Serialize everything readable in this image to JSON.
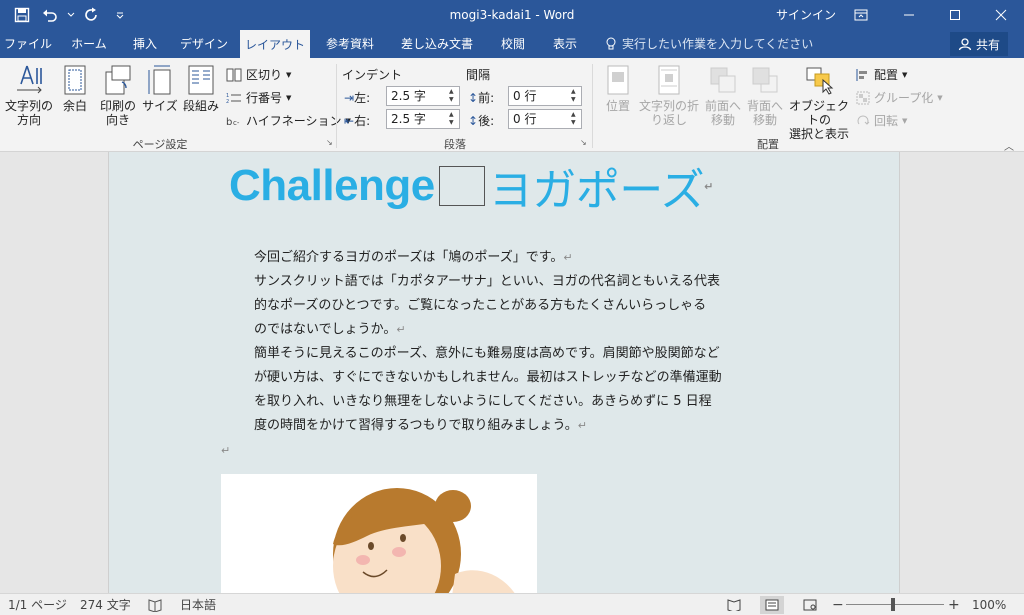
{
  "window": {
    "title": "mogi3-kadai1  -  Word",
    "signin": "サインイン"
  },
  "tabs": [
    {
      "label": "ファイル"
    },
    {
      "label": "ホーム"
    },
    {
      "label": "挿入"
    },
    {
      "label": "デザイン"
    },
    {
      "label": "レイアウト",
      "active": true
    },
    {
      "label": "参考資料"
    },
    {
      "label": "差し込み文書"
    },
    {
      "label": "校閲"
    },
    {
      "label": "表示"
    }
  ],
  "tell_me": "実行したい作業を入力してください",
  "share": "共有",
  "ribbon": {
    "page_setup": {
      "text_direction": "文字列の\n方向",
      "margins": "余白",
      "orientation": "印刷の\n向き",
      "size": "サイズ",
      "columns": "段組み",
      "breaks": "区切り",
      "line_numbers": "行番号",
      "hyphenation": "ハイフネーション",
      "group_label": "ページ設定"
    },
    "paragraph": {
      "indent_header": "インデント",
      "spacing_header": "間隔",
      "left_label": "左:",
      "left_value": "2.5 字",
      "right_label": "右:",
      "right_value": "2.5 字",
      "before_label": "前:",
      "before_value": "0 行",
      "after_label": "後:",
      "after_value": "0 行",
      "group_label": "段落"
    },
    "arrange": {
      "position": "位置",
      "wrap_text": "文字列の折\nり返し",
      "bring_forward": "前面へ\n移動",
      "send_backward": "背面へ\n移動",
      "selection_pane": "オブジェクトの\n選択と表示",
      "align": "配置",
      "group": "グループ化",
      "rotate": "回転",
      "group_label": "配置"
    }
  },
  "document": {
    "heading_left": "Challenge",
    "heading_right": "ヨガポーズ",
    "lines": [
      "今回ご紹介するヨガのポーズは「鳩のポーズ」です。",
      "サンスクリット語では「カポタアーサナ」といい、ヨガの代名詞ともいえる代表",
      "的なポーズのひとつです。ご覧になったことがある方もたくさんいらっしゃる",
      "のではないでしょうか。",
      "簡単そうに見えるこのポーズ、意外にも難易度は高めです。肩関節や股関節など",
      "が硬い方は、すぐにできないかもしれません。最初はストレッチなどの準備運動",
      "を取り入れ、いきなり無理をしないようにしてください。あきらめずに 5 日程",
      "度の時間をかけて習得するつもりで取り組みましょう。"
    ]
  },
  "status": {
    "page": "1/1 ページ",
    "words": "274 文字",
    "language": "日本語",
    "zoom": "100%"
  },
  "colors": {
    "accent": "#2b579a",
    "heading": "#2aaee4",
    "page_bg": "#dfe8ea"
  }
}
